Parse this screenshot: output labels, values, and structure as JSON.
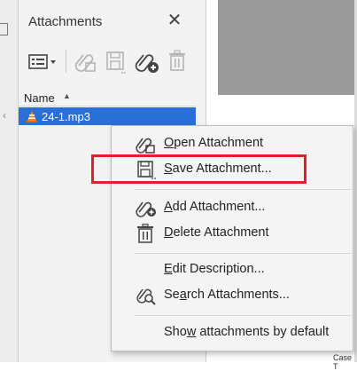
{
  "panel": {
    "title": "Attachments",
    "close_glyph": "✕",
    "toolbar": [
      {
        "name": "options-menu-icon"
      },
      {
        "name": "open-attachment-icon"
      },
      {
        "name": "save-attachment-icon"
      },
      {
        "name": "add-attachment-icon"
      },
      {
        "name": "delete-attachment-icon"
      }
    ],
    "list": {
      "column_header": "Name",
      "sort_glyph": "▲",
      "items": [
        {
          "name": "24-1.mp3",
          "icon": "vlc-cone-icon",
          "selected": true
        }
      ]
    }
  },
  "context_menu": {
    "items": [
      {
        "label": "Open Attachment",
        "mnemonic": "O",
        "icon": "open-attachment-icon"
      },
      {
        "label": "Save Attachment...",
        "mnemonic": "S",
        "icon": "save-attachment-icon",
        "highlighted": true
      },
      {
        "label": "Add Attachment...",
        "mnemonic": "A",
        "icon": "add-attachment-icon"
      },
      {
        "label": "Delete Attachment",
        "mnemonic": "D",
        "icon": "delete-attachment-icon"
      },
      {
        "label": "Edit Description...",
        "mnemonic": "E"
      },
      {
        "label": "Search Attachments...",
        "mnemonic": "a",
        "icon": "search-attachments-icon"
      },
      {
        "label": "Show attachments by default",
        "mnemonic": "w"
      }
    ]
  },
  "document": {
    "corner_text": "Case T"
  },
  "colors": {
    "selection": "#2a6fd6",
    "highlight_box": "#e0202a",
    "menu_bg": "#f4f4f4",
    "panel_bg": "#f3f3f3"
  }
}
